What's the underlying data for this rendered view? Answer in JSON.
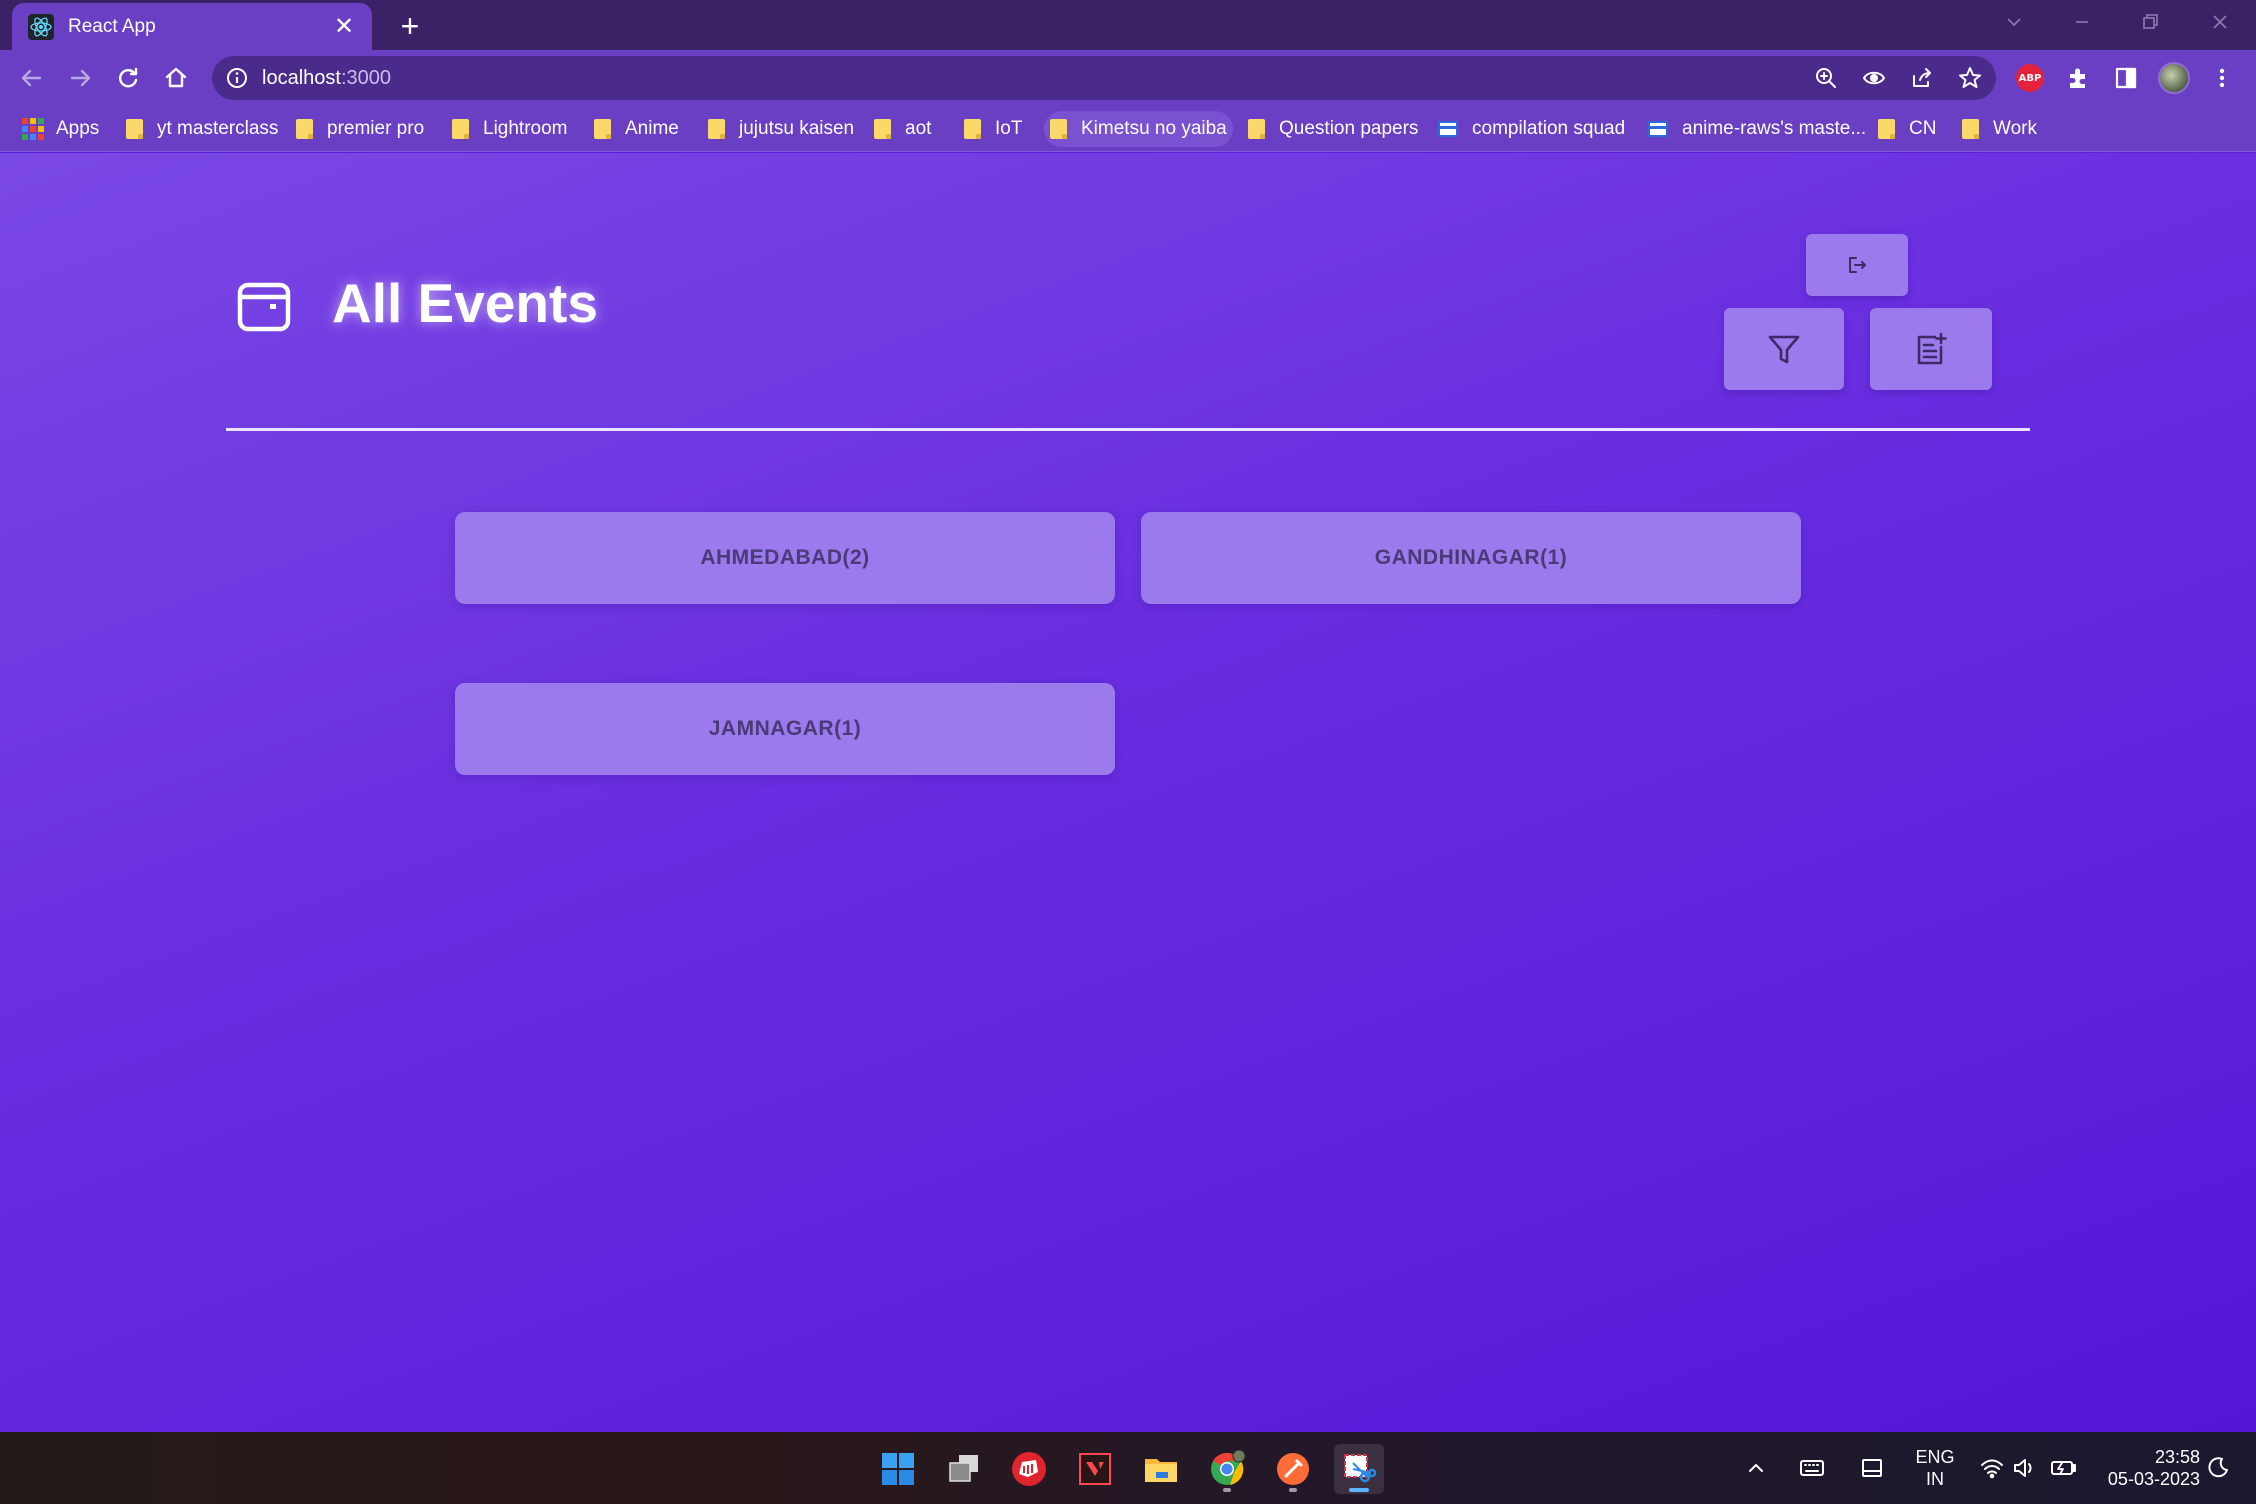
{
  "browser": {
    "tab_title": "React App",
    "tab_close": "✕",
    "new_tab": "+",
    "url_host": "localhost",
    "url_port": ":3000"
  },
  "bookmarks": [
    {
      "label": "Apps",
      "icon": "apps-grid-icon"
    },
    {
      "label": "yt masterclass",
      "icon": "folder-icon"
    },
    {
      "label": "premier pro",
      "icon": "folder-icon"
    },
    {
      "label": "Lightroom",
      "icon": "folder-icon"
    },
    {
      "label": "Anime",
      "icon": "folder-icon"
    },
    {
      "label": "jujutsu kaisen",
      "icon": "folder-icon"
    },
    {
      "label": "aot",
      "icon": "folder-icon"
    },
    {
      "label": "IoT",
      "icon": "folder-icon"
    },
    {
      "label": "Kimetsu no yaiba",
      "icon": "folder-icon"
    },
    {
      "label": "Question papers",
      "icon": "folder-icon"
    },
    {
      "label": "compilation squad",
      "icon": "site-icon"
    },
    {
      "label": "anime-raws's maste...",
      "icon": "site-icon"
    },
    {
      "label": "CN",
      "icon": "folder-icon"
    },
    {
      "label": "Work",
      "icon": "folder-icon"
    }
  ],
  "page": {
    "title": "All Events",
    "cities": [
      "AHMEDABAD(2)",
      "GANDHINAGAR(1)",
      "JAMNAGAR(1)"
    ]
  },
  "taskbar": {
    "lang_line1": "ENG",
    "lang_line2": "IN",
    "time": "23:58",
    "date": "05-03-2023"
  },
  "colors": {
    "accent": "#9b7aed",
    "tab_bg": "#6a3fc4",
    "page_gradient_start": "#7a48e4",
    "page_gradient_end": "#5516d8"
  }
}
